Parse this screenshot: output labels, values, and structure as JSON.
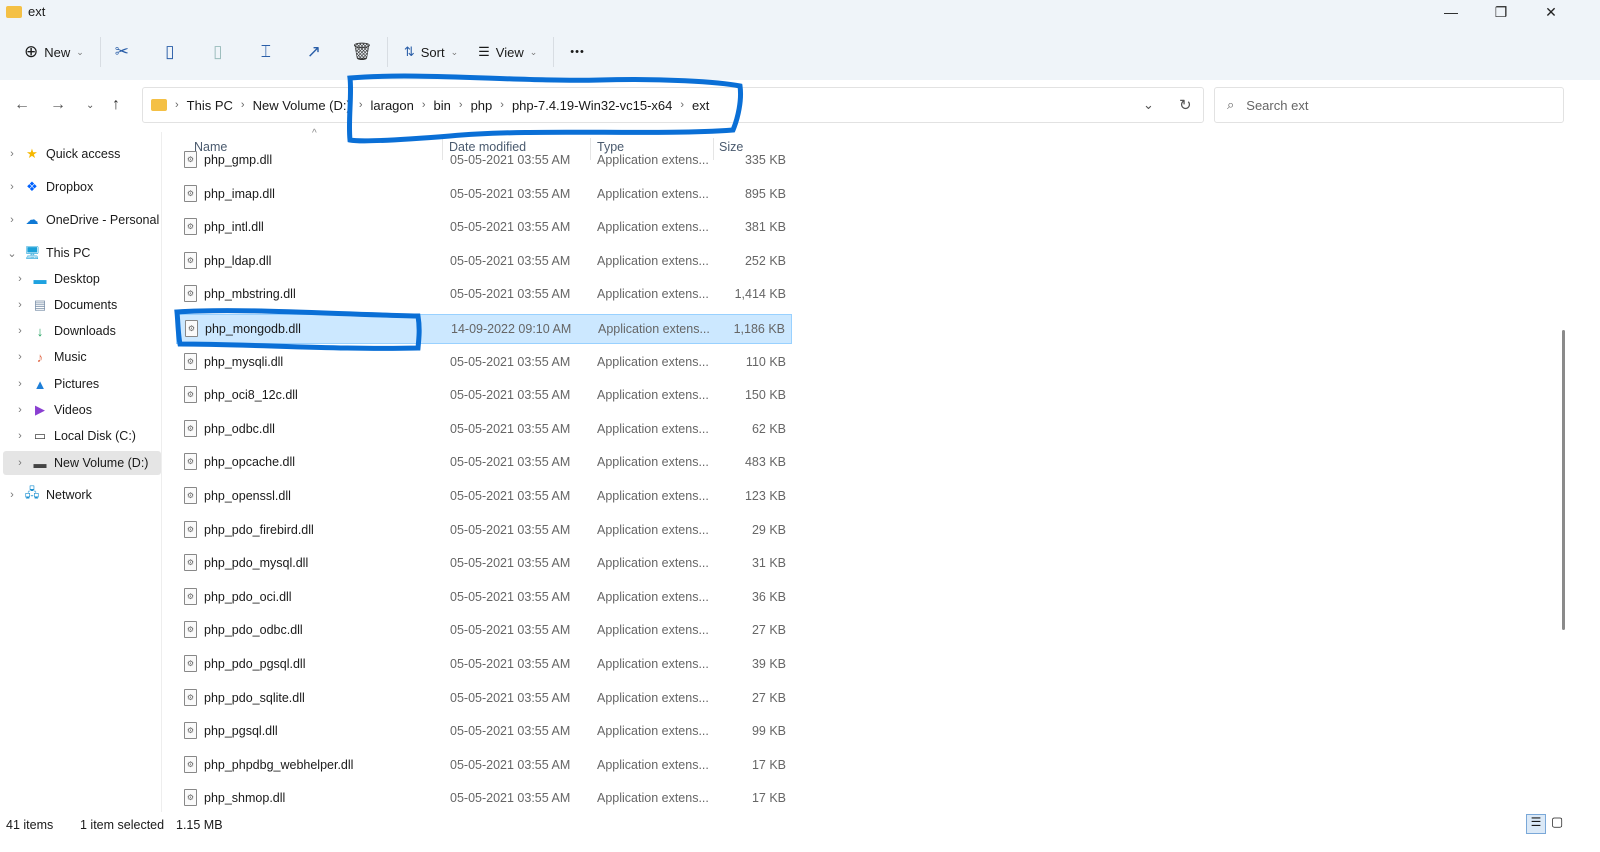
{
  "window": {
    "title": "ext",
    "minimize": "—",
    "maximize": "❐",
    "close": "✕"
  },
  "toolbar": {
    "new": "New",
    "sort": "Sort",
    "view": "View",
    "more": "•••"
  },
  "address": {
    "crumbs": [
      "This PC",
      "New Volume (D:)",
      "laragon",
      "bin",
      "php",
      "php-7.4.19-Win32-vc15-x64",
      "ext"
    ]
  },
  "search": {
    "placeholder": "Search ext"
  },
  "sidebar": {
    "items": [
      {
        "label": "Quick access",
        "icon": "★"
      },
      {
        "label": "Dropbox",
        "icon": "❖"
      },
      {
        "label": "OneDrive - Personal",
        "icon": "☁"
      },
      {
        "label": "This PC",
        "icon": "🖥"
      },
      {
        "label": "Desktop",
        "icon": "▬"
      },
      {
        "label": "Documents",
        "icon": "▤"
      },
      {
        "label": "Downloads",
        "icon": "↓"
      },
      {
        "label": "Music",
        "icon": "♪"
      },
      {
        "label": "Pictures",
        "icon": "▲"
      },
      {
        "label": "Videos",
        "icon": "▶"
      },
      {
        "label": "Local Disk (C:)",
        "icon": "▭"
      },
      {
        "label": "New Volume (D:)",
        "icon": "▬"
      },
      {
        "label": "Network",
        "icon": "🖧"
      }
    ]
  },
  "columns": {
    "name": "Name",
    "date": "Date modified",
    "type": "Type",
    "size": "Size"
  },
  "files": [
    {
      "name": "php_gmp.dll",
      "date": "05-05-2021 03:55 AM",
      "type": "Application extens...",
      "size": "335 KB"
    },
    {
      "name": "php_imap.dll",
      "date": "05-05-2021 03:55 AM",
      "type": "Application extens...",
      "size": "895 KB"
    },
    {
      "name": "php_intl.dll",
      "date": "05-05-2021 03:55 AM",
      "type": "Application extens...",
      "size": "381 KB"
    },
    {
      "name": "php_ldap.dll",
      "date": "05-05-2021 03:55 AM",
      "type": "Application extens...",
      "size": "252 KB"
    },
    {
      "name": "php_mbstring.dll",
      "date": "05-05-2021 03:55 AM",
      "type": "Application extens...",
      "size": "1,414 KB"
    },
    {
      "name": "php_mongodb.dll",
      "date": "14-09-2022 09:10 AM",
      "type": "Application extens...",
      "size": "1,186 KB"
    },
    {
      "name": "php_mysqli.dll",
      "date": "05-05-2021 03:55 AM",
      "type": "Application extens...",
      "size": "110 KB"
    },
    {
      "name": "php_oci8_12c.dll",
      "date": "05-05-2021 03:55 AM",
      "type": "Application extens...",
      "size": "150 KB"
    },
    {
      "name": "php_odbc.dll",
      "date": "05-05-2021 03:55 AM",
      "type": "Application extens...",
      "size": "62 KB"
    },
    {
      "name": "php_opcache.dll",
      "date": "05-05-2021 03:55 AM",
      "type": "Application extens...",
      "size": "483 KB"
    },
    {
      "name": "php_openssl.dll",
      "date": "05-05-2021 03:55 AM",
      "type": "Application extens...",
      "size": "123 KB"
    },
    {
      "name": "php_pdo_firebird.dll",
      "date": "05-05-2021 03:55 AM",
      "type": "Application extens...",
      "size": "29 KB"
    },
    {
      "name": "php_pdo_mysql.dll",
      "date": "05-05-2021 03:55 AM",
      "type": "Application extens...",
      "size": "31 KB"
    },
    {
      "name": "php_pdo_oci.dll",
      "date": "05-05-2021 03:55 AM",
      "type": "Application extens...",
      "size": "36 KB"
    },
    {
      "name": "php_pdo_odbc.dll",
      "date": "05-05-2021 03:55 AM",
      "type": "Application extens...",
      "size": "27 KB"
    },
    {
      "name": "php_pdo_pgsql.dll",
      "date": "05-05-2021 03:55 AM",
      "type": "Application extens...",
      "size": "39 KB"
    },
    {
      "name": "php_pdo_sqlite.dll",
      "date": "05-05-2021 03:55 AM",
      "type": "Application extens...",
      "size": "27 KB"
    },
    {
      "name": "php_pgsql.dll",
      "date": "05-05-2021 03:55 AM",
      "type": "Application extens...",
      "size": "99 KB"
    },
    {
      "name": "php_phpdbg_webhelper.dll",
      "date": "05-05-2021 03:55 AM",
      "type": "Application extens...",
      "size": "17 KB"
    },
    {
      "name": "php_shmop.dll",
      "date": "05-05-2021 03:55 AM",
      "type": "Application extens...",
      "size": "17 KB"
    }
  ],
  "status": {
    "count": "41 items",
    "selected": "1 item selected",
    "size": "1.15 MB"
  },
  "colors": {
    "selection": "#cce8ff",
    "annotation": "#0a6fd6"
  }
}
